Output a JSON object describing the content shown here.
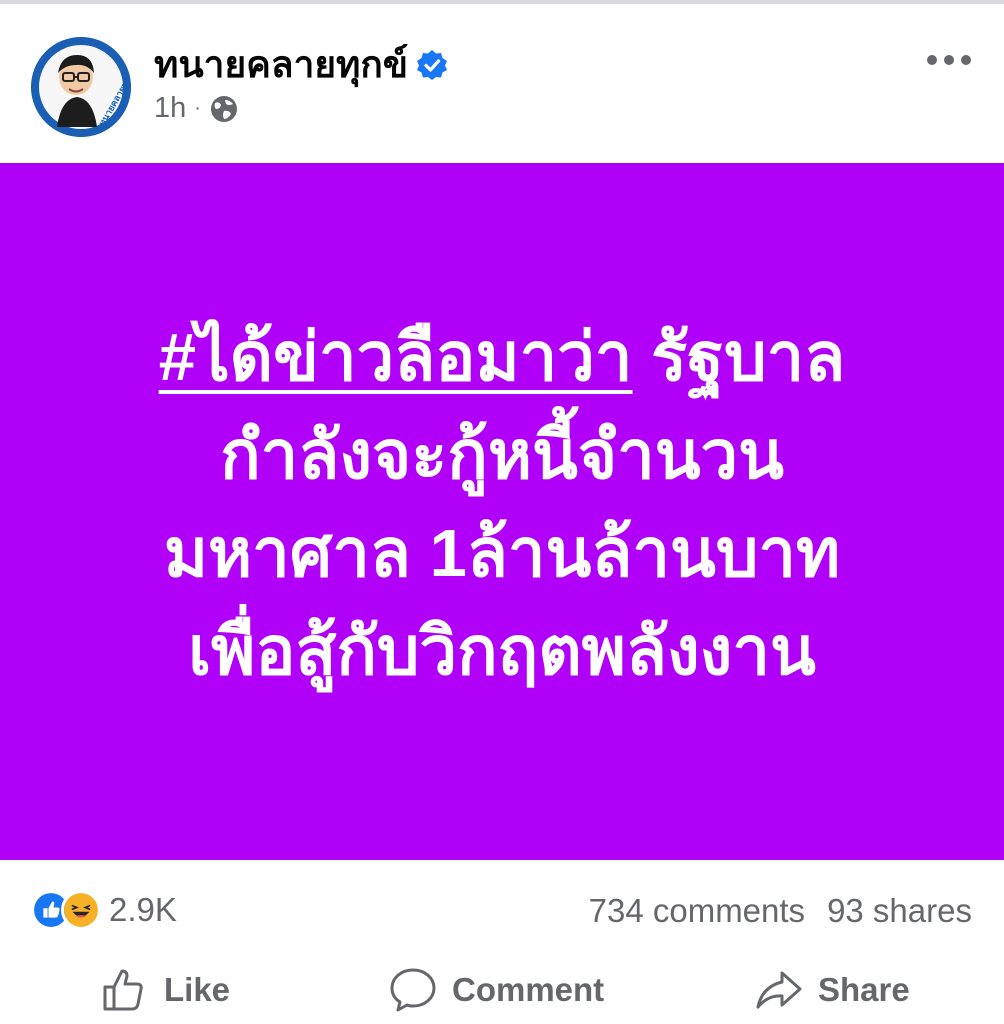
{
  "post": {
    "author": "ทนายคลายทุกข์",
    "time": "1h",
    "separator": "·",
    "avatar_text": "ทนายคลายทุกข์",
    "icons": {
      "verified": "verified-badge-icon",
      "audience": "globe-icon",
      "menu": "more-icon"
    }
  },
  "content": {
    "hashtag": "#ได้ข่าวลือมาว่า",
    "line1_rest": " รัฐบาล",
    "line2": "กำลังจะกู้หนี้จำนวน",
    "line3": "มหาศาล 1ล้านล้านบาท",
    "line4": "เพื่อสู้กับวิกฤตพลังงาน",
    "background_color": "#b000f7"
  },
  "stats": {
    "reactions_count": "2.9K",
    "comments": "734 comments",
    "shares": "93 shares",
    "reaction_icons": [
      "like-icon",
      "haha-icon"
    ]
  },
  "actions": {
    "like": "Like",
    "comment": "Comment",
    "share": "Share"
  }
}
